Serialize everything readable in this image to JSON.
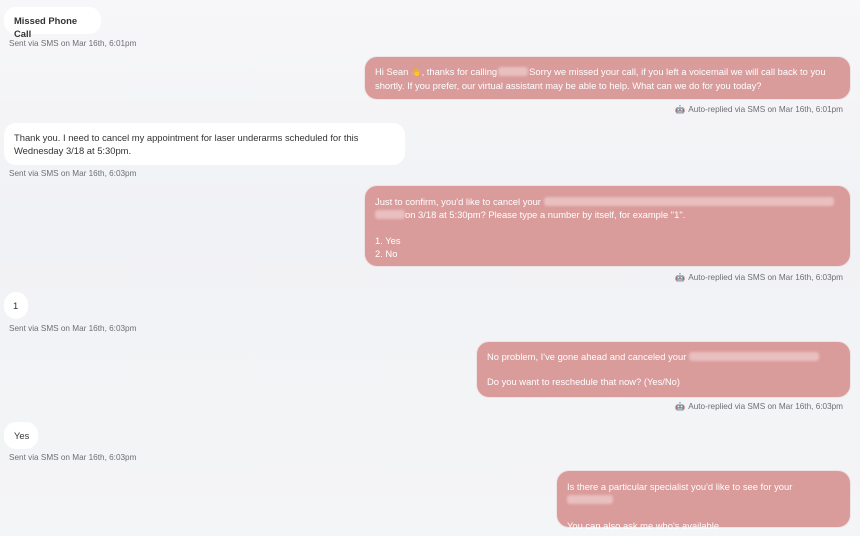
{
  "messages": {
    "m1": {
      "text": "Missed Phone Call",
      "meta": "Sent via SMS on Mar 16th, 6:01pm"
    },
    "m2": {
      "part1": "Hi Sean ",
      "emoji": "👋",
      "part2": ", thanks for calling",
      "part3": "Sorry we missed your call, if you left a voicemail we will call back to you shortly. If you prefer, our virtual assistant may be able to help. What can we do for you today?",
      "meta": "Auto-replied via SMS on Mar 16th, 6:01pm"
    },
    "m3": {
      "text": "Thank you. I need to cancel my appointment for laser underarms scheduled for this Wednesday 3/18 at 5:30pm.",
      "meta": "Sent via SMS on Mar 16th, 6:03pm"
    },
    "m4": {
      "part1": "Just to confirm, you'd like to cancel your",
      "part2": "on 3/18 at 5:30pm? Please type a number by itself, for example \"1\".",
      "opt1": "1. Yes",
      "opt2": "2. No",
      "meta": "Auto-replied via SMS on Mar 16th, 6:03pm"
    },
    "m5": {
      "text": "1",
      "meta": "Sent via SMS on Mar 16th, 6:03pm"
    },
    "m6": {
      "part1": "No problem, I've gone ahead and canceled your",
      "part2": "Do you want to reschedule that now? (Yes/No)",
      "meta": "Auto-replied via SMS on Mar 16th, 6:03pm"
    },
    "m7": {
      "text": "Yes",
      "meta": "Sent via SMS on Mar 16th, 6:03pm"
    },
    "m8": {
      "part1": "Is there a particular specialist you'd like to see for your",
      "part2": "You can also ask me who's available."
    }
  },
  "icons": {
    "auto_reply": "robot-icon"
  },
  "colors": {
    "outgoing_bubble": "#da9b9b",
    "incoming_bubble": "#ffffff"
  }
}
